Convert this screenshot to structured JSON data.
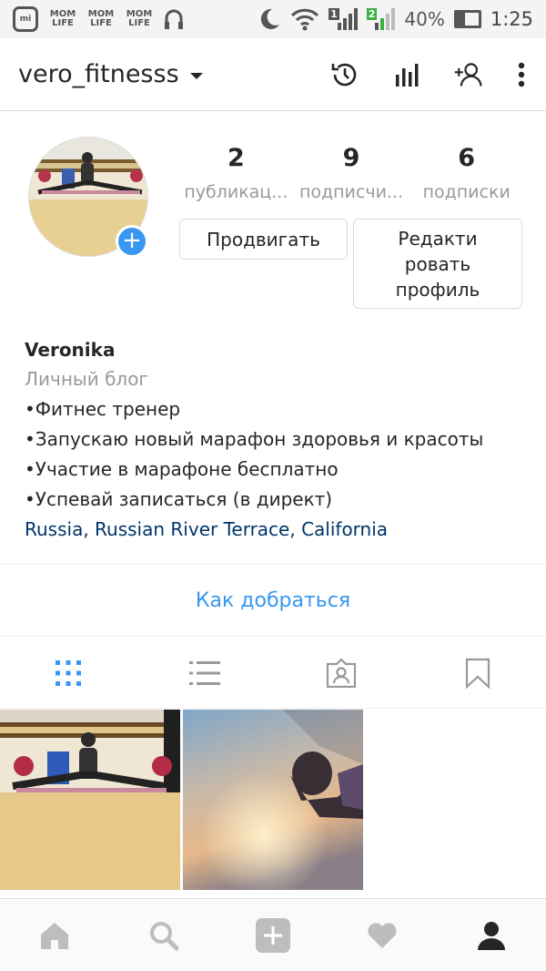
{
  "status_bar": {
    "mom_label": "MOM LIFE",
    "sim1": "1",
    "sim2": "2",
    "battery": "40%",
    "battery_level": 0.4,
    "time": "1:25"
  },
  "header": {
    "username": "vero_fitnesss",
    "icons": [
      "history-icon",
      "insights-icon",
      "add-user-icon",
      "more-options-icon"
    ]
  },
  "profile": {
    "stats": [
      {
        "count": "2",
        "label": "публикац..."
      },
      {
        "count": "9",
        "label": "подписчи..."
      },
      {
        "count": "6",
        "label": "подписки"
      }
    ],
    "promote_label": "Продвигать",
    "edit_label": "Редакти ровать профиль",
    "add_badge": "+"
  },
  "bio": {
    "name": "Veronika",
    "category": "Личный блог",
    "lines": [
      "•Фитнес тренер",
      "•Запускаю новый марафон здоровья и красоты",
      "•Участие в марафоне бесплатно",
      "•Успевай записаться (в директ)"
    ],
    "location": "Russia, Russian River Terrace, California"
  },
  "directions_label": "Как добраться",
  "tabs": [
    "grid-icon",
    "list-icon",
    "tagged-icon",
    "saved-icon"
  ],
  "colors": {
    "accent": "#3897f0",
    "link": "#003569",
    "text": "#262626",
    "muted": "#999999"
  },
  "bottom_nav": [
    "home-icon",
    "search-icon",
    "add-post-icon",
    "activity-heart-icon",
    "profile-icon"
  ]
}
